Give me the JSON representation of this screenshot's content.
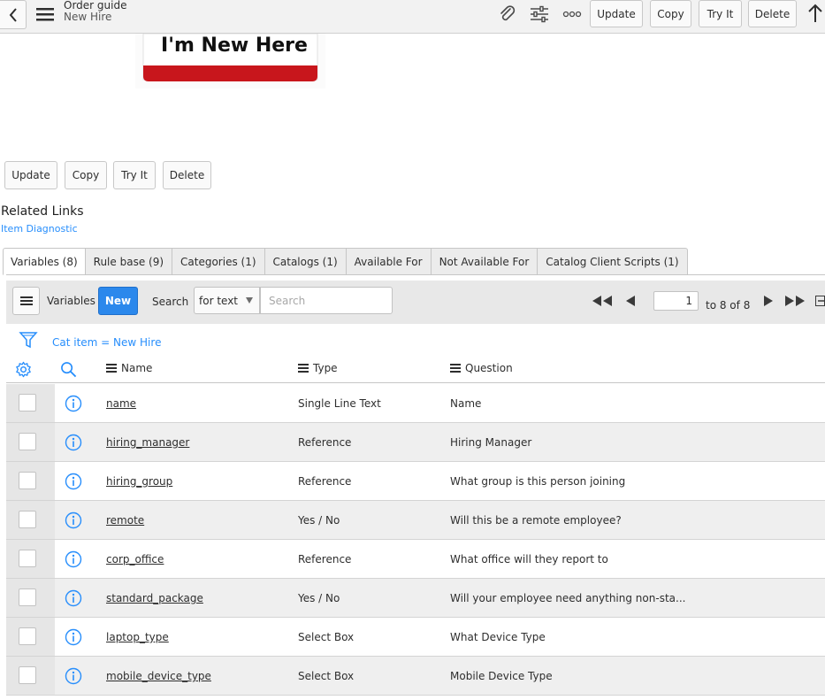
{
  "header": {
    "title": "Order guide",
    "subtitle": "New Hire",
    "buttons": {
      "update": "Update",
      "copy": "Copy",
      "try_it": "Try It",
      "delete": "Delete"
    }
  },
  "image": {
    "badge_text": "I'm New Here"
  },
  "actions": {
    "update": "Update",
    "copy": "Copy",
    "try_it": "Try It",
    "delete": "Delete"
  },
  "related": {
    "title": "Related Links",
    "link": "Item Diagnostic"
  },
  "tabs": [
    {
      "label": "Variables (8)"
    },
    {
      "label": "Rule base (9)"
    },
    {
      "label": "Categories (1)"
    },
    {
      "label": "Catalogs (1)"
    },
    {
      "label": "Available For"
    },
    {
      "label": "Not Available For"
    },
    {
      "label": "Catalog Client Scripts (1)"
    }
  ],
  "list": {
    "title": "Variables",
    "new_label": "New",
    "search_label": "Search",
    "search_field_selected": "for text",
    "search_placeholder": "Search",
    "page_value": "1",
    "page_of": "to 8 of 8",
    "filter": "Cat item = New Hire",
    "columns": {
      "name": "Name",
      "type": "Type",
      "question": "Question"
    },
    "rows": [
      {
        "name": "name",
        "type": "Single Line Text",
        "question": "Name"
      },
      {
        "name": "hiring_manager",
        "type": "Reference",
        "question": "Hiring Manager"
      },
      {
        "name": "hiring_group",
        "type": "Reference",
        "question": "What group is this person joining"
      },
      {
        "name": "remote",
        "type": "Yes / No",
        "question": "Will this be a remote employee?"
      },
      {
        "name": "corp_office",
        "type": "Reference",
        "question": "What office will they report to"
      },
      {
        "name": "standard_package",
        "type": "Yes / No",
        "question": "Will your employee need anything non-sta..."
      },
      {
        "name": "laptop_type",
        "type": "Select Box",
        "question": "What Device Type"
      },
      {
        "name": "mobile_device_type",
        "type": "Select Box",
        "question": "Mobile Device Type"
      }
    ]
  },
  "colors": {
    "accent": "#278efc",
    "primary_button": "#2b88ec",
    "header_bg": "#f2f2f2",
    "badge_red": "#c8161c"
  },
  "icons": [
    "chevron-left-icon",
    "hamburger-icon",
    "paperclip-icon",
    "sliders-icon",
    "more-icon",
    "arrow-up-icon",
    "gear-icon",
    "search-icon",
    "filter-icon",
    "info-icon",
    "first-page-icon",
    "prev-page-icon",
    "next-page-icon",
    "last-page-icon"
  ]
}
